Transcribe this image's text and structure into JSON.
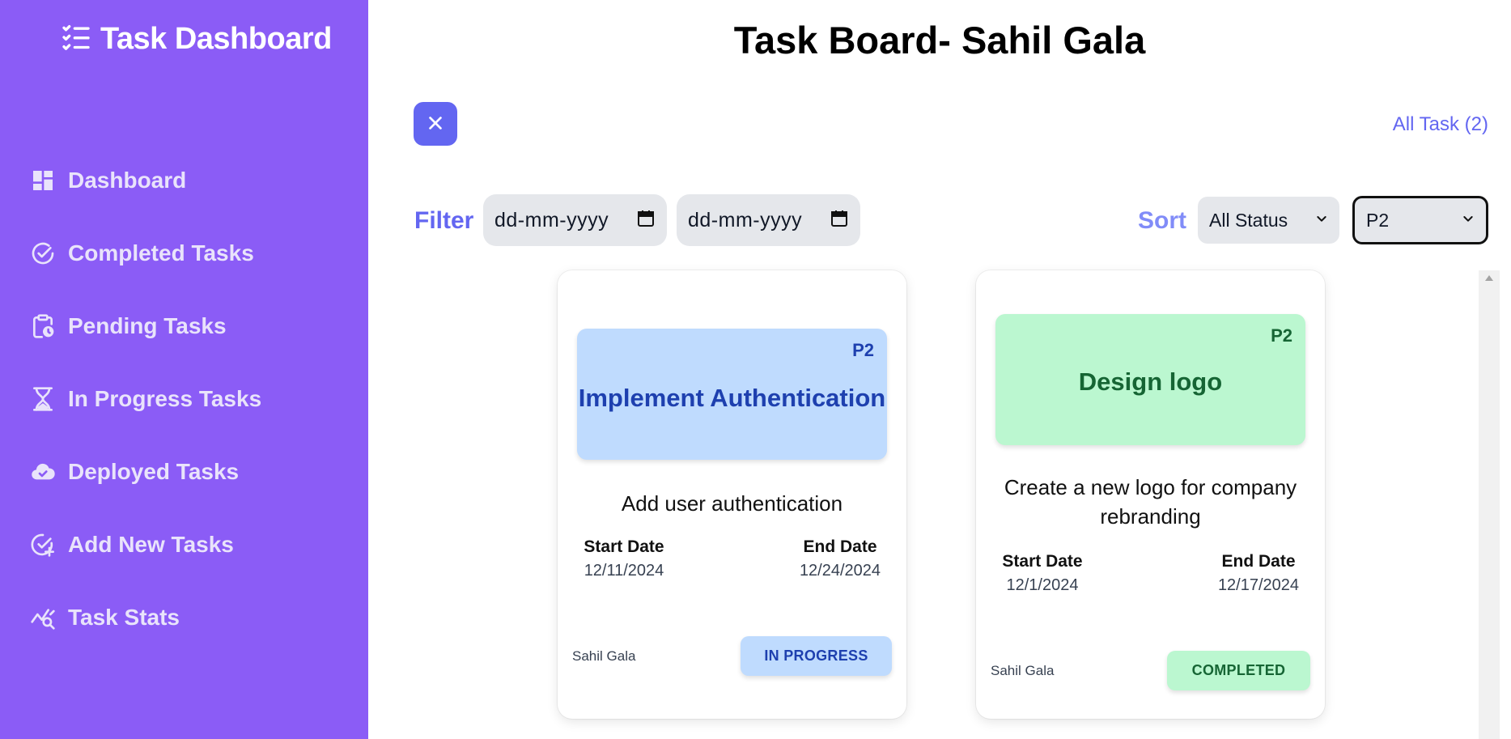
{
  "sidebar": {
    "brand": "Task Dashboard",
    "items": [
      {
        "label": "Dashboard",
        "icon": "dashboard-icon"
      },
      {
        "label": "Completed Tasks",
        "icon": "check-circle-icon"
      },
      {
        "label": "Pending Tasks",
        "icon": "clipboard-clock-icon"
      },
      {
        "label": "In Progress Tasks",
        "icon": "hourglass-icon"
      },
      {
        "label": "Deployed Tasks",
        "icon": "cloud-check-icon"
      },
      {
        "label": "Add New Tasks",
        "icon": "check-plus-icon"
      },
      {
        "label": "Task Stats",
        "icon": "chart-search-icon"
      }
    ]
  },
  "header": {
    "title": "Task Board- Sahil Gala",
    "all_task": "All Task (2)"
  },
  "filters": {
    "label": "Filter",
    "start_placeholder": "dd-mm-yyyy",
    "end_placeholder": "dd-mm-yyyy",
    "sort_label": "Sort",
    "status_value": "All Status",
    "priority_value": "P2"
  },
  "cards": [
    {
      "priority": "P2",
      "title": "Implement Authentication",
      "description": "Add user authentication",
      "start_label": "Start Date",
      "start_date": "12/11/2024",
      "end_label": "End Date",
      "end_date": "12/24/2024",
      "owner": "Sahil Gala",
      "status": "IN PROGRESS"
    },
    {
      "priority": "P2",
      "title": "Design logo",
      "description": "Create a new logo for company rebranding",
      "start_label": "Start Date",
      "start_date": "12/1/2024",
      "end_label": "End Date",
      "end_date": "12/17/2024",
      "owner": "Sahil Gala",
      "status": "COMPLETED"
    }
  ],
  "colors": {
    "sidebar": "#8b5cf6",
    "accent": "#6366f1",
    "card1_banner": "#bfdbfe",
    "card1_text": "#1e40af",
    "card2_banner": "#bbf7d0",
    "card2_text": "#166534"
  }
}
